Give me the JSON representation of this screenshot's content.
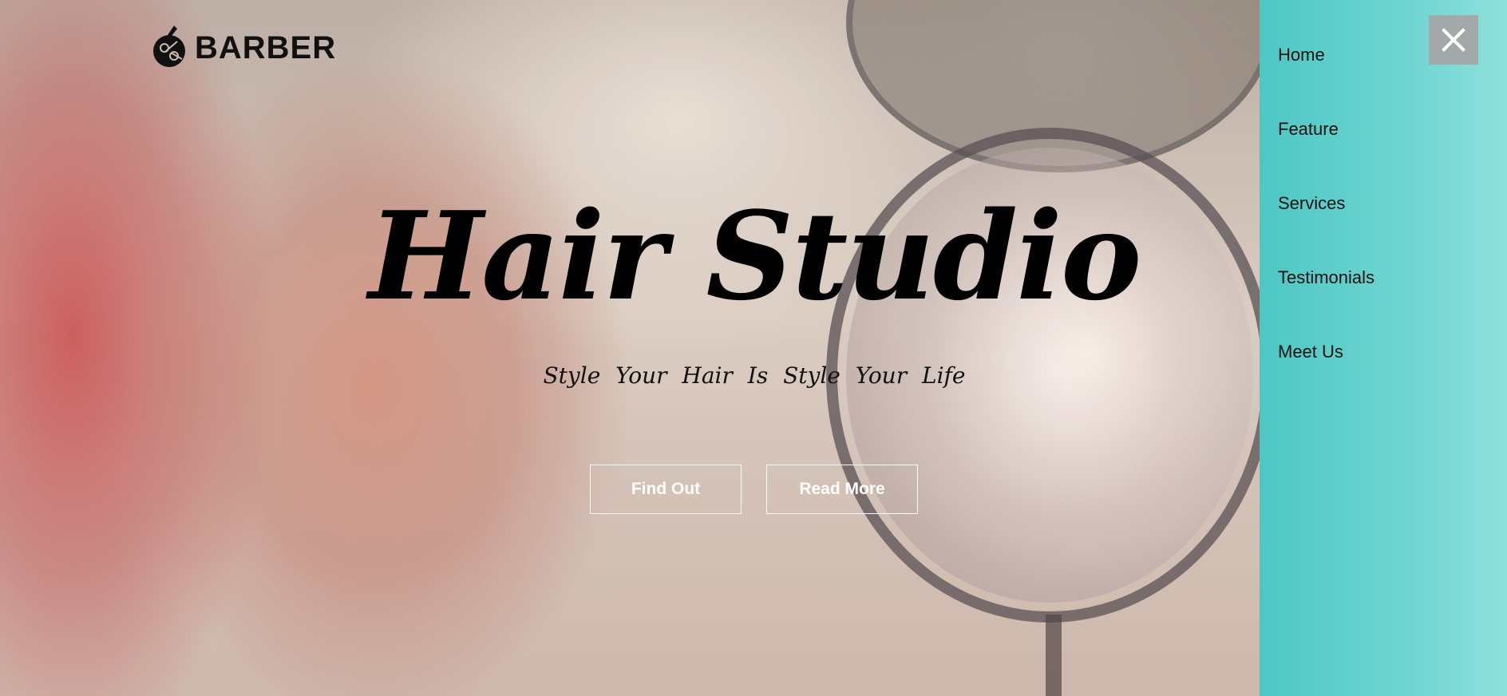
{
  "brand": {
    "logo_text": "BARBER",
    "logo_icon": "barber-scissors-logo-icon"
  },
  "hero": {
    "title": "Hair Studio",
    "subtitle": "Style Your Hair Is Style Your Life",
    "buttons": [
      {
        "label": "Find Out"
      },
      {
        "label": "Read More"
      }
    ]
  },
  "side_menu": {
    "close_icon": "close-icon",
    "items": [
      {
        "label": "Home"
      },
      {
        "label": "Feature"
      },
      {
        "label": "Services"
      },
      {
        "label": "Testimonials"
      },
      {
        "label": "Meet Us"
      }
    ]
  },
  "colors": {
    "menu_background": "#4ec7c4",
    "close_button": "#a3a9a9",
    "button_border": "#ffffff"
  }
}
